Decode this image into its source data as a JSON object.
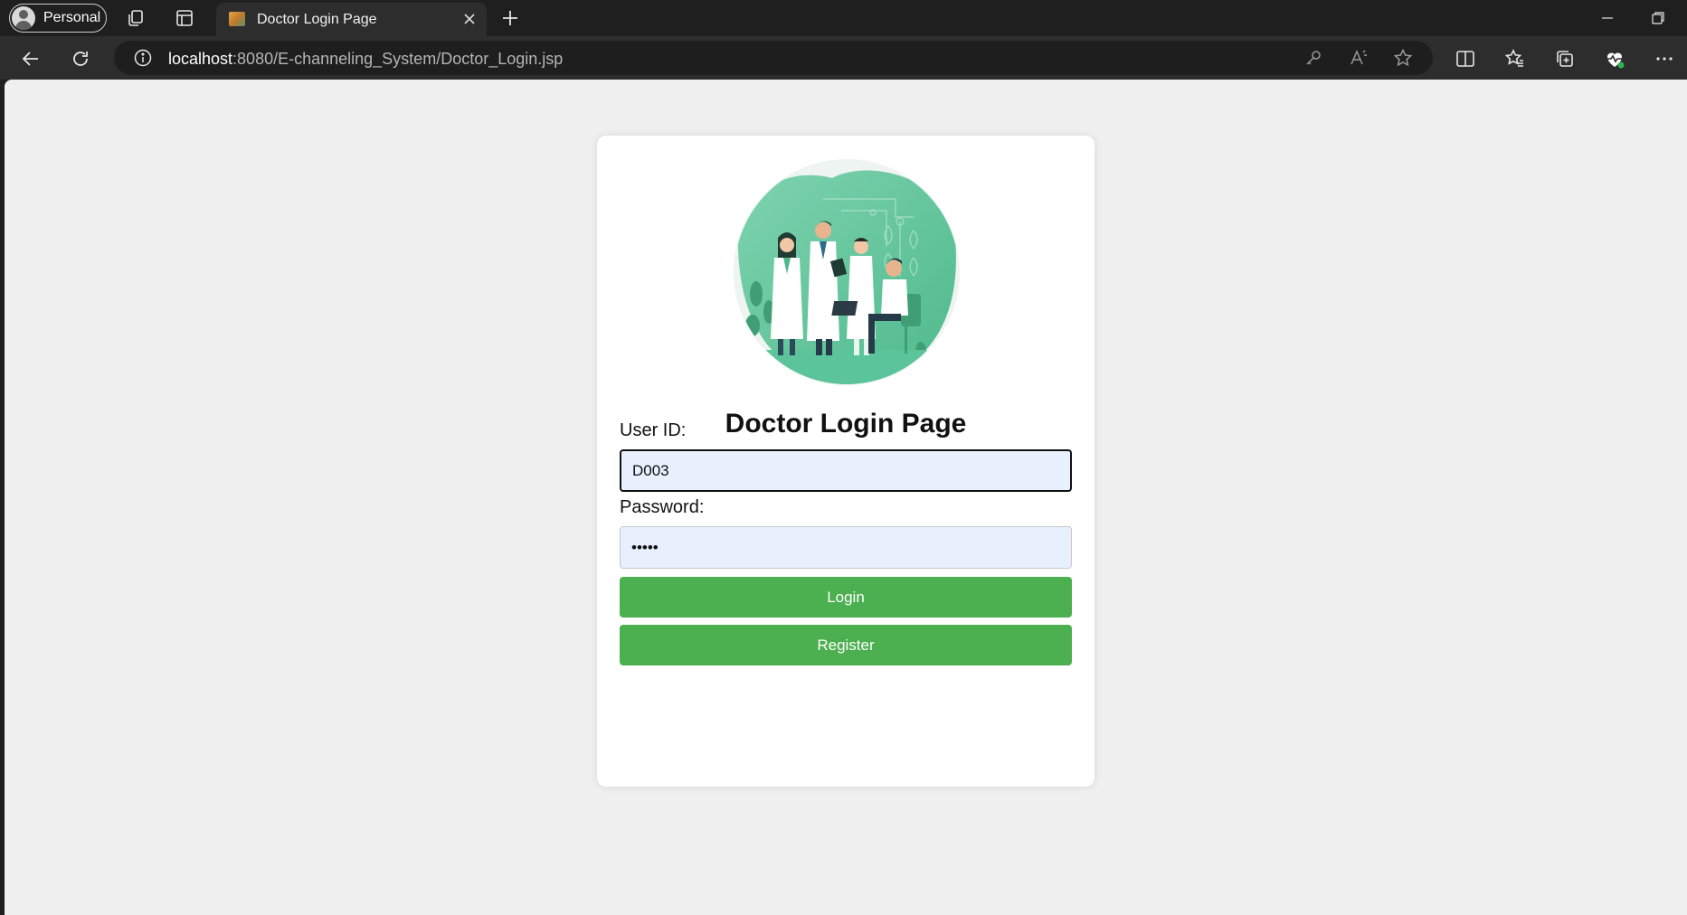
{
  "browser": {
    "profile_label": "Personal",
    "tab_title": "Doctor Login Page",
    "url_host": "localhost",
    "url_rest": ":8080/E-channeling_System/Doctor_Login.jsp"
  },
  "page": {
    "heading": "Doctor Login Page",
    "user_id_label": "User ID:",
    "user_id_value": "D003",
    "password_label": "Password:",
    "password_value": "•••••",
    "login_label": "Login",
    "register_label": "Register"
  },
  "colors": {
    "button": "#4caf50",
    "input_fill": "#e8f0fe",
    "page_bg": "#f0f0f0",
    "illustration_accent": "#5cc49a"
  },
  "icons": [
    "profile-avatar-icon",
    "workspaces-icon",
    "tab-actions-icon",
    "favicon-icon",
    "close-icon",
    "new-tab-icon",
    "minimize-icon",
    "restore-icon",
    "back-icon",
    "refresh-icon",
    "site-info-icon",
    "key-icon",
    "read-aloud-icon",
    "favorite-star-icon",
    "split-screen-icon",
    "favorites-icon",
    "collections-icon",
    "health-icon",
    "more-icon"
  ]
}
